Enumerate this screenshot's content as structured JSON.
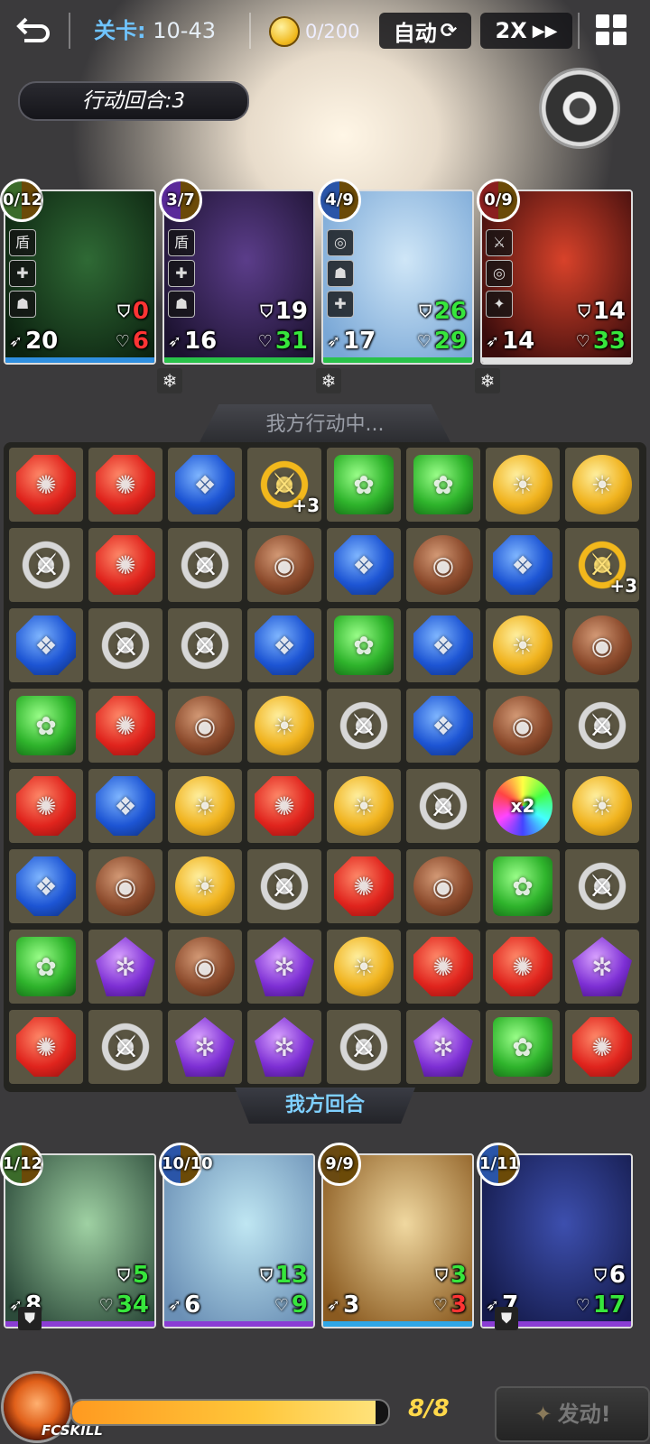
{
  "topbar": {
    "stage_label": "关卡:",
    "stage_value": "10-43",
    "currency": "0/200",
    "auto_label": "自动",
    "speed_label": "2X"
  },
  "turns": {
    "label": "行动回合:",
    "value": "3"
  },
  "enemies": [
    {
      "badge": "0/12",
      "badge_color": "#3b6b2a",
      "skills": [
        "盾",
        "✚",
        "☗"
      ],
      "def": "0",
      "def_color": "red",
      "atk": "20",
      "hp": "6",
      "hp_color": "red",
      "bar": "#2f8fe0",
      "art": [
        "#2f6a35",
        "#0c2210"
      ],
      "frozen": false
    },
    {
      "badge": "3/7",
      "badge_color": "#5a2a9a",
      "skills": [
        "盾",
        "✚",
        "☗"
      ],
      "def": "19",
      "def_color": "white",
      "atk": "16",
      "hp": "31",
      "hp_color": "green",
      "bar": "#29c24a",
      "art": [
        "#5b3d8a",
        "#1c1230"
      ],
      "frozen": true
    },
    {
      "badge": "4/9",
      "badge_color": "#2a55a8",
      "skills": [
        "◎",
        "☗",
        "✚"
      ],
      "def": "26",
      "def_color": "green",
      "atk": "17",
      "hp": "29",
      "hp_color": "green",
      "bar": "#29c24a",
      "art": [
        "#cfe6f7",
        "#79a7d6"
      ],
      "frozen": true
    },
    {
      "badge": "0/9",
      "badge_color": "#8a1f1f",
      "skills": [
        "⚔",
        "◎",
        "✦"
      ],
      "def": "14",
      "def_color": "white",
      "atk": "14",
      "hp": "33",
      "hp_color": "green",
      "bar": "#e0e0e0",
      "art": [
        "#d8422a",
        "#3a0c0c"
      ],
      "frozen": true
    }
  ],
  "board": {
    "title": "我方行动中...",
    "turn_label": "我方回合",
    "rows": [
      [
        "red",
        "red",
        "blue",
        "gsword+3",
        "green",
        "green",
        "yellow",
        "yellow"
      ],
      [
        "sword",
        "red",
        "sword",
        "brown",
        "blue",
        "brown",
        "blue",
        "gsword+3"
      ],
      [
        "blue",
        "sword",
        "sword",
        "blue",
        "green",
        "blue",
        "yellow",
        "brown"
      ],
      [
        "green",
        "red",
        "brown",
        "yellow",
        "sword",
        "blue",
        "brown",
        "sword"
      ],
      [
        "red",
        "blue",
        "yellow",
        "red",
        "yellow",
        "sword",
        "rainbow",
        "yellow"
      ],
      [
        "blue",
        "brown",
        "yellow",
        "sword",
        "red",
        "brown",
        "green",
        "sword"
      ],
      [
        "green",
        "purple",
        "brown",
        "purple",
        "yellow",
        "red",
        "red",
        "purple"
      ],
      [
        "red",
        "sword",
        "purple",
        "purple",
        "sword",
        "purple",
        "green",
        "red"
      ]
    ],
    "multiplier_text": "x2"
  },
  "allies": [
    {
      "badge": "1/12",
      "badge_color": "#3b6b2a",
      "def": "5",
      "def_color": "green",
      "atk": "8",
      "hp": "34",
      "hp_color": "green",
      "bar": "#8a3dd4",
      "art": [
        "#9fd1a3",
        "#2c4a3a"
      ],
      "shield": true
    },
    {
      "badge": "10/10",
      "badge_color": "#2a55a8",
      "def": "13",
      "def_color": "green",
      "atk": "6",
      "hp": "9",
      "hp_color": "green",
      "bar": "#8a3dd4",
      "art": [
        "#bfe6f2",
        "#6a8fb5"
      ],
      "shield": false
    },
    {
      "badge": "9/9",
      "badge_color": "#6a4a12",
      "def": "3",
      "def_color": "green",
      "atk": "3",
      "hp": "3",
      "hp_color": "red",
      "bar": "#2fa6e6",
      "art": [
        "#f0d8a0",
        "#8a5a20"
      ],
      "shield": false
    },
    {
      "badge": "1/11",
      "badge_color": "#2a55a8",
      "def": "6",
      "def_color": "white",
      "atk": "7",
      "hp": "17",
      "hp_color": "green",
      "bar": "#8a3dd4",
      "art": [
        "#3d4fae",
        "#141a4a"
      ],
      "shield": true
    }
  ],
  "bottom": {
    "skill_label": "FCSKILL",
    "energy_text": "8/8",
    "energy_fraction": 0.96,
    "launch_label": "发动!"
  }
}
